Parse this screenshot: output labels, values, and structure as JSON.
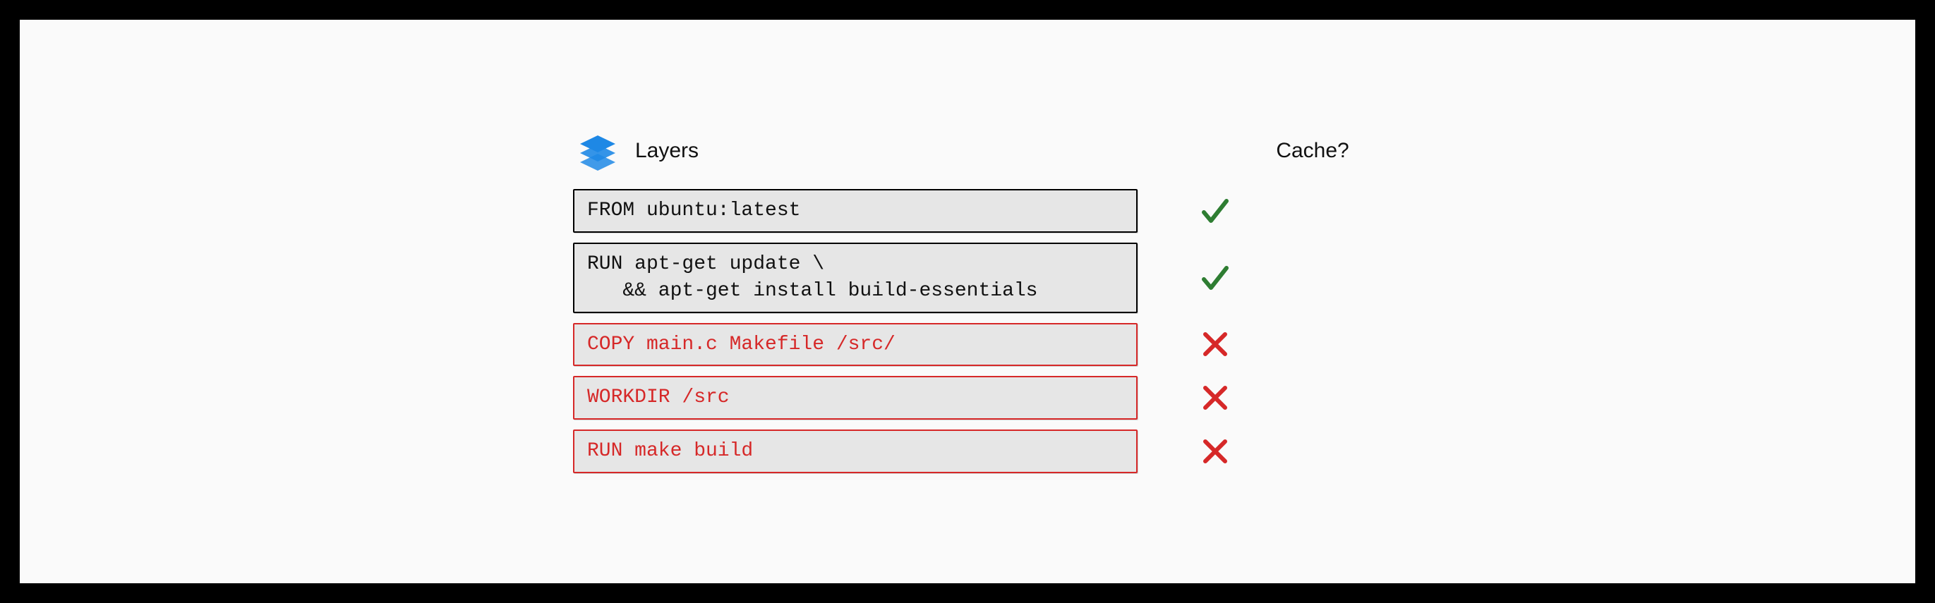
{
  "header": {
    "layers_label": "Layers",
    "cache_label": "Cache?"
  },
  "colors": {
    "ok": "#2e7d32",
    "bad": "#d62828",
    "box_bg": "#e6e6e6",
    "canvas_bg": "#fafafa",
    "icon_blue": "#1e88e5"
  },
  "layers": [
    {
      "code": "FROM ubuntu:latest",
      "cached": true,
      "invalidated": false
    },
    {
      "code": "RUN apt-get update \\\n   && apt-get install build-essentials",
      "cached": true,
      "invalidated": false
    },
    {
      "code": "COPY main.c Makefile /src/",
      "cached": false,
      "invalidated": true
    },
    {
      "code": "WORKDIR /src",
      "cached": false,
      "invalidated": true
    },
    {
      "code": "RUN make build",
      "cached": false,
      "invalidated": true
    }
  ]
}
